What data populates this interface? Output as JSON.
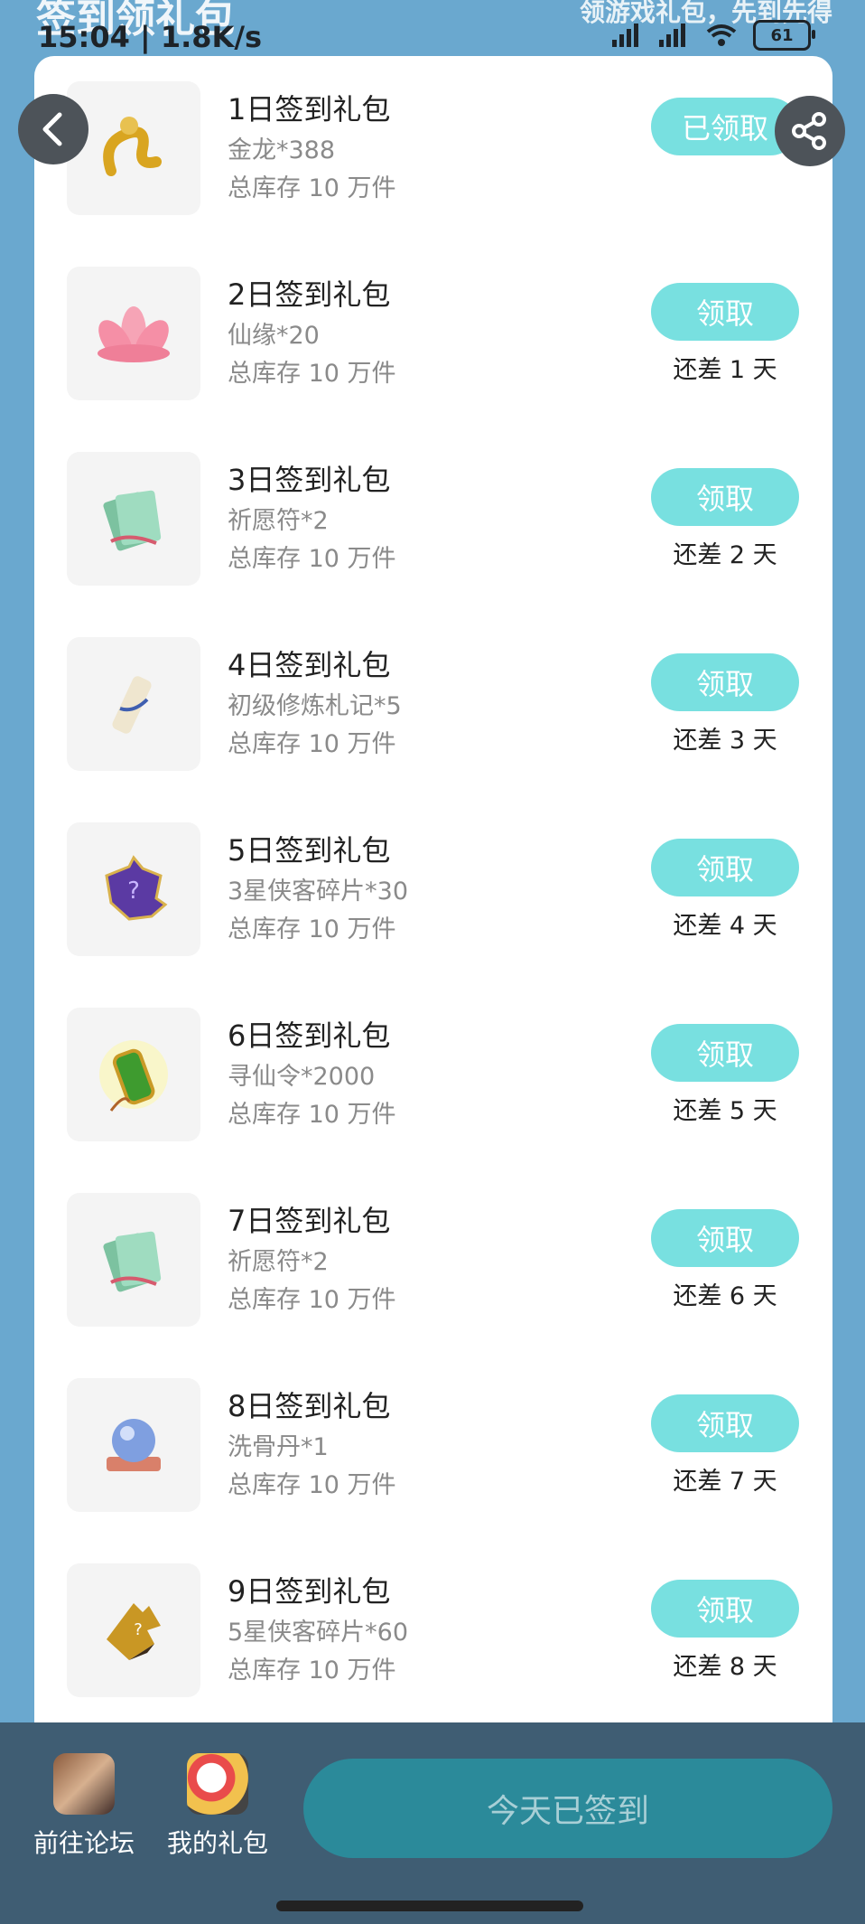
{
  "status": {
    "time": "15:04",
    "speed": "1.8K/s",
    "battery": "61",
    "faded_title": "签到领礼包",
    "faded_subtitle": "领游戏礼包，先到先得"
  },
  "colors": {
    "page_bg": "#6aa8cf",
    "claim_button": "#78e0e0",
    "bottom_bar": "#3f5d73",
    "checkin_button": "#2b8a9a"
  },
  "gifts": [
    {
      "title": "1日签到礼包",
      "item": "金龙*388",
      "stock": "总库存 10 万件",
      "button": "已领取",
      "remain": "",
      "icon": "golden-dragon-icon"
    },
    {
      "title": "2日签到礼包",
      "item": "仙缘*20",
      "stock": "总库存 10 万件",
      "button": "领取",
      "remain": "还差 1 天",
      "icon": "lotus-icon"
    },
    {
      "title": "3日签到礼包",
      "item": "祈愿符*2",
      "stock": "总库存 10 万件",
      "button": "领取",
      "remain": "还差 2 天",
      "icon": "wish-talisman-icon"
    },
    {
      "title": "4日签到礼包",
      "item": "初级修炼札记*5",
      "stock": "总库存 10 万件",
      "button": "领取",
      "remain": "还差 3 天",
      "icon": "scroll-icon"
    },
    {
      "title": "5日签到礼包",
      "item": "3星侠客碎片*30",
      "stock": "总库存 10 万件",
      "button": "领取",
      "remain": "还差 4 天",
      "icon": "purple-puzzle-icon"
    },
    {
      "title": "6日签到礼包",
      "item": "寻仙令*2000",
      "stock": "总库存 10 万件",
      "button": "领取",
      "remain": "还差 5 天",
      "icon": "jade-token-icon"
    },
    {
      "title": "7日签到礼包",
      "item": "祈愿符*2",
      "stock": "总库存 10 万件",
      "button": "领取",
      "remain": "还差 6 天",
      "icon": "wish-talisman-icon"
    },
    {
      "title": "8日签到礼包",
      "item": "洗骨丹*1",
      "stock": "总库存 10 万件",
      "button": "领取",
      "remain": "还差 7 天",
      "icon": "crystal-ball-icon"
    },
    {
      "title": "9日签到礼包",
      "item": "5星侠客碎片*60",
      "stock": "总库存 10 万件",
      "button": "领取",
      "remain": "还差 8 天",
      "icon": "gold-puzzle-icon"
    }
  ],
  "bottom": {
    "forum_label": "前往论坛",
    "mygifts_label": "我的礼包",
    "checkin_label": "今天已签到"
  }
}
